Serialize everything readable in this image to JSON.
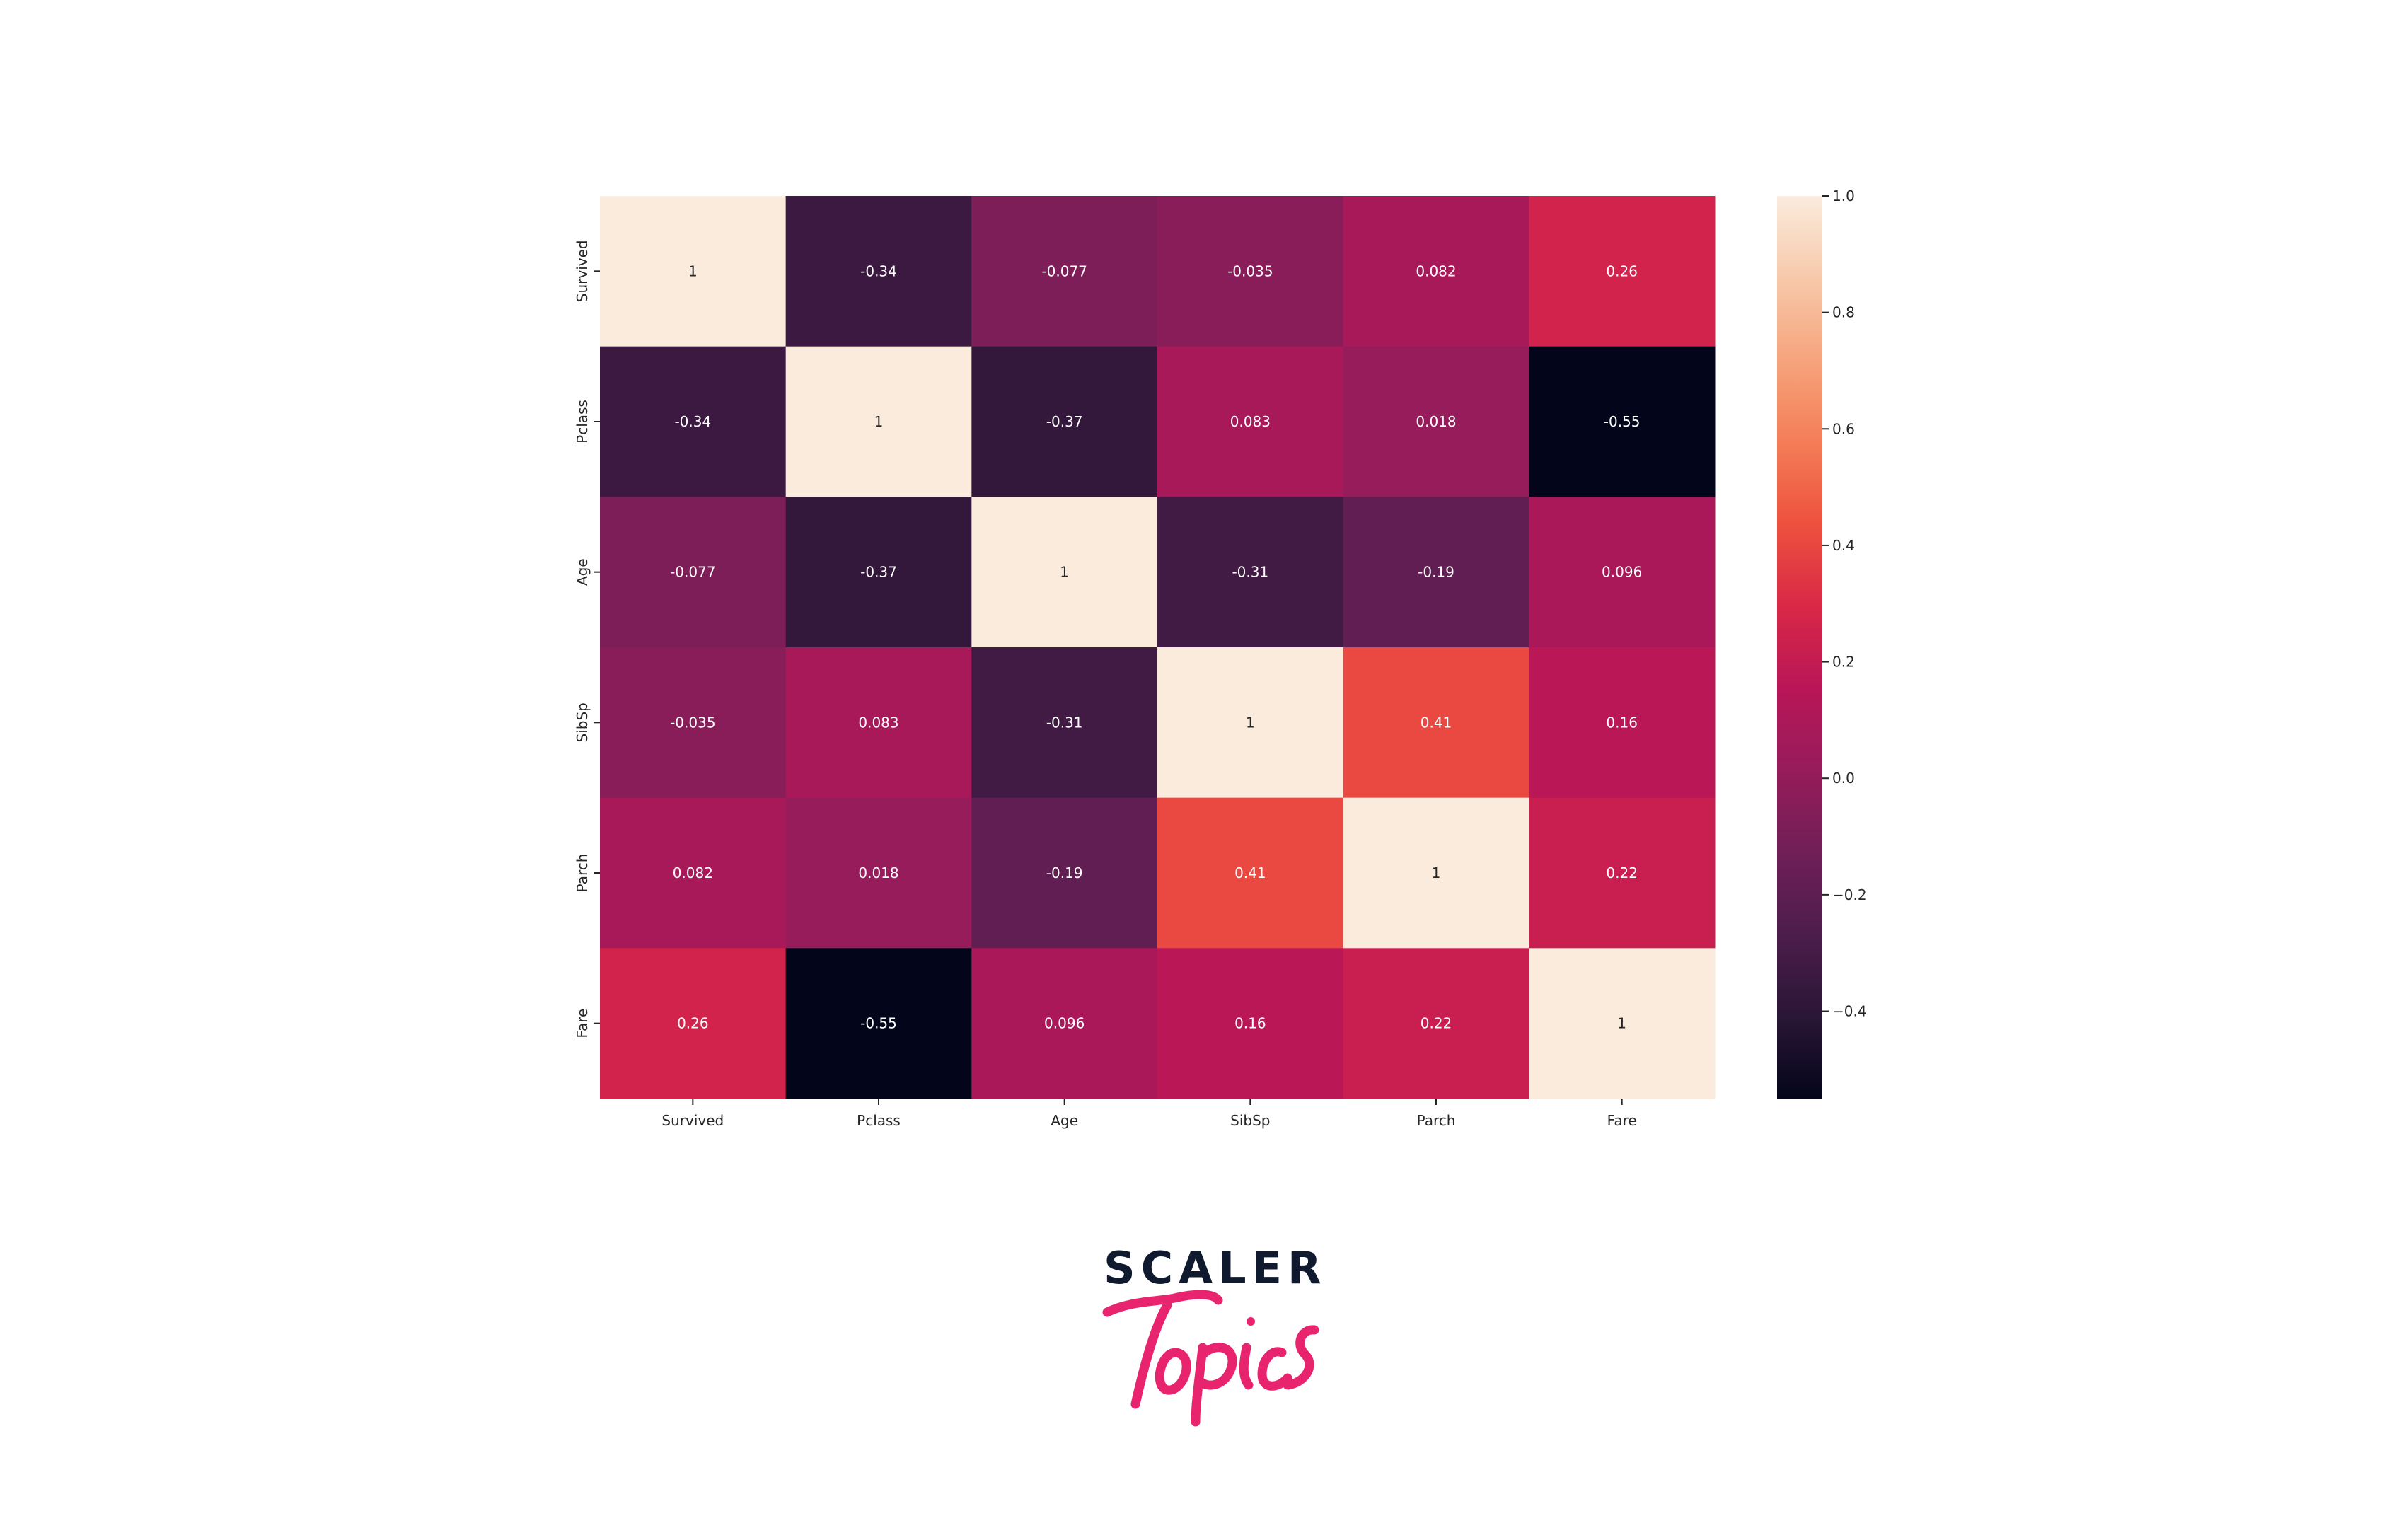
{
  "chart_data": {
    "type": "heatmap",
    "title": "",
    "xlabel": "",
    "ylabel": "",
    "x_categories": [
      "Survived",
      "Pclass",
      "Age",
      "SibSp",
      "Parch",
      "Fare"
    ],
    "y_categories": [
      "Survived",
      "Pclass",
      "Age",
      "SibSp",
      "Parch",
      "Fare"
    ],
    "values": [
      [
        1,
        -0.34,
        -0.077,
        -0.035,
        0.082,
        0.26
      ],
      [
        -0.34,
        1,
        -0.37,
        0.083,
        0.018,
        -0.55
      ],
      [
        -0.077,
        -0.37,
        1,
        -0.31,
        -0.19,
        0.096
      ],
      [
        -0.035,
        0.083,
        -0.31,
        1,
        0.41,
        0.16
      ],
      [
        0.082,
        0.018,
        -0.19,
        0.41,
        1,
        0.22
      ],
      [
        0.26,
        -0.55,
        0.096,
        0.16,
        0.22,
        1
      ]
    ],
    "annotations": [
      [
        "1",
        "-0.34",
        "-0.077",
        "-0.035",
        "0.082",
        "0.26"
      ],
      [
        "-0.34",
        "1",
        "-0.37",
        "0.083",
        "0.018",
        "-0.55"
      ],
      [
        "-0.077",
        "-0.37",
        "1",
        "-0.31",
        "-0.19",
        "0.096"
      ],
      [
        "-0.035",
        "0.083",
        "-0.31",
        "1",
        "0.41",
        "0.16"
      ],
      [
        "0.082",
        "0.018",
        "-0.19",
        "0.41",
        "1",
        "0.22"
      ],
      [
        "0.26",
        "-0.55",
        "0.096",
        "0.16",
        "0.22",
        "1"
      ]
    ],
    "colormap": "rocket",
    "colorbar": {
      "range": [
        -0.55,
        1.0
      ],
      "ticks": [
        1.0,
        0.8,
        0.6,
        0.4,
        0.2,
        0.0,
        -0.2,
        -0.4
      ],
      "tick_labels": [
        "1.0",
        "0.8",
        "0.6",
        "0.4",
        "0.2",
        "0.0",
        "−0.2",
        "−0.4"
      ],
      "placement": "right"
    },
    "grid": false,
    "legend": "none"
  },
  "colors": {
    "rocket_stops": [
      "#03051a",
      "#2a1636",
      "#4c1d4b",
      "#701f57",
      "#961c5b",
      "#b91657",
      "#d92847",
      "#ed513e",
      "#f47d57",
      "#f6a47c",
      "#f7c9aa",
      "#faebdd"
    ],
    "light_text": "#ffffff",
    "dark_text": "#262626"
  },
  "branding": {
    "logo_line1": "SCALER",
    "logo_line2": "Topics",
    "logo_line1_color": "#0f1a2e",
    "logo_line2_color": "#e8246f"
  }
}
